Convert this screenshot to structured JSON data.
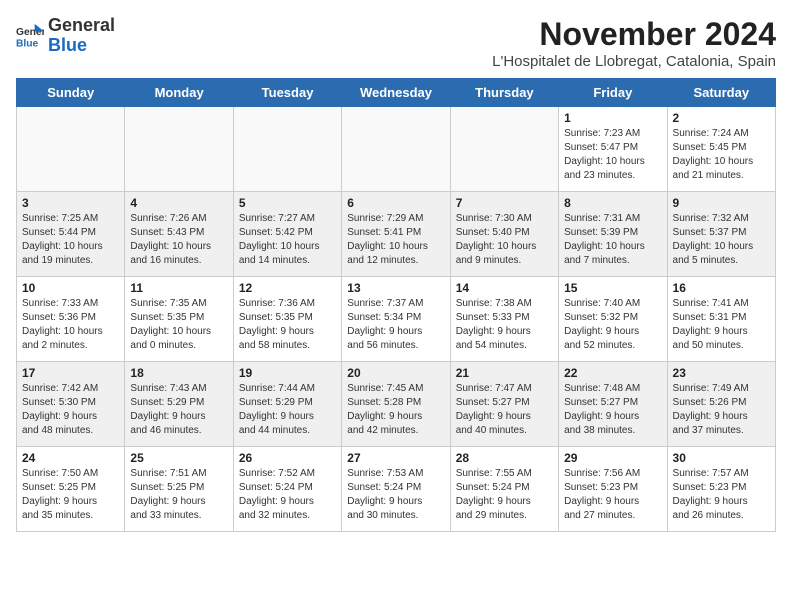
{
  "header": {
    "logo_general": "General",
    "logo_blue": "Blue",
    "month_title": "November 2024",
    "location": "L'Hospitalet de Llobregat, Catalonia, Spain"
  },
  "weekdays": [
    "Sunday",
    "Monday",
    "Tuesday",
    "Wednesday",
    "Thursday",
    "Friday",
    "Saturday"
  ],
  "weeks": [
    [
      {
        "day": "",
        "info": ""
      },
      {
        "day": "",
        "info": ""
      },
      {
        "day": "",
        "info": ""
      },
      {
        "day": "",
        "info": ""
      },
      {
        "day": "",
        "info": ""
      },
      {
        "day": "1",
        "info": "Sunrise: 7:23 AM\nSunset: 5:47 PM\nDaylight: 10 hours\nand 23 minutes."
      },
      {
        "day": "2",
        "info": "Sunrise: 7:24 AM\nSunset: 5:45 PM\nDaylight: 10 hours\nand 21 minutes."
      }
    ],
    [
      {
        "day": "3",
        "info": "Sunrise: 7:25 AM\nSunset: 5:44 PM\nDaylight: 10 hours\nand 19 minutes."
      },
      {
        "day": "4",
        "info": "Sunrise: 7:26 AM\nSunset: 5:43 PM\nDaylight: 10 hours\nand 16 minutes."
      },
      {
        "day": "5",
        "info": "Sunrise: 7:27 AM\nSunset: 5:42 PM\nDaylight: 10 hours\nand 14 minutes."
      },
      {
        "day": "6",
        "info": "Sunrise: 7:29 AM\nSunset: 5:41 PM\nDaylight: 10 hours\nand 12 minutes."
      },
      {
        "day": "7",
        "info": "Sunrise: 7:30 AM\nSunset: 5:40 PM\nDaylight: 10 hours\nand 9 minutes."
      },
      {
        "day": "8",
        "info": "Sunrise: 7:31 AM\nSunset: 5:39 PM\nDaylight: 10 hours\nand 7 minutes."
      },
      {
        "day": "9",
        "info": "Sunrise: 7:32 AM\nSunset: 5:37 PM\nDaylight: 10 hours\nand 5 minutes."
      }
    ],
    [
      {
        "day": "10",
        "info": "Sunrise: 7:33 AM\nSunset: 5:36 PM\nDaylight: 10 hours\nand 2 minutes."
      },
      {
        "day": "11",
        "info": "Sunrise: 7:35 AM\nSunset: 5:35 PM\nDaylight: 10 hours\nand 0 minutes."
      },
      {
        "day": "12",
        "info": "Sunrise: 7:36 AM\nSunset: 5:35 PM\nDaylight: 9 hours\nand 58 minutes."
      },
      {
        "day": "13",
        "info": "Sunrise: 7:37 AM\nSunset: 5:34 PM\nDaylight: 9 hours\nand 56 minutes."
      },
      {
        "day": "14",
        "info": "Sunrise: 7:38 AM\nSunset: 5:33 PM\nDaylight: 9 hours\nand 54 minutes."
      },
      {
        "day": "15",
        "info": "Sunrise: 7:40 AM\nSunset: 5:32 PM\nDaylight: 9 hours\nand 52 minutes."
      },
      {
        "day": "16",
        "info": "Sunrise: 7:41 AM\nSunset: 5:31 PM\nDaylight: 9 hours\nand 50 minutes."
      }
    ],
    [
      {
        "day": "17",
        "info": "Sunrise: 7:42 AM\nSunset: 5:30 PM\nDaylight: 9 hours\nand 48 minutes."
      },
      {
        "day": "18",
        "info": "Sunrise: 7:43 AM\nSunset: 5:29 PM\nDaylight: 9 hours\nand 46 minutes."
      },
      {
        "day": "19",
        "info": "Sunrise: 7:44 AM\nSunset: 5:29 PM\nDaylight: 9 hours\nand 44 minutes."
      },
      {
        "day": "20",
        "info": "Sunrise: 7:45 AM\nSunset: 5:28 PM\nDaylight: 9 hours\nand 42 minutes."
      },
      {
        "day": "21",
        "info": "Sunrise: 7:47 AM\nSunset: 5:27 PM\nDaylight: 9 hours\nand 40 minutes."
      },
      {
        "day": "22",
        "info": "Sunrise: 7:48 AM\nSunset: 5:27 PM\nDaylight: 9 hours\nand 38 minutes."
      },
      {
        "day": "23",
        "info": "Sunrise: 7:49 AM\nSunset: 5:26 PM\nDaylight: 9 hours\nand 37 minutes."
      }
    ],
    [
      {
        "day": "24",
        "info": "Sunrise: 7:50 AM\nSunset: 5:25 PM\nDaylight: 9 hours\nand 35 minutes."
      },
      {
        "day": "25",
        "info": "Sunrise: 7:51 AM\nSunset: 5:25 PM\nDaylight: 9 hours\nand 33 minutes."
      },
      {
        "day": "26",
        "info": "Sunrise: 7:52 AM\nSunset: 5:24 PM\nDaylight: 9 hours\nand 32 minutes."
      },
      {
        "day": "27",
        "info": "Sunrise: 7:53 AM\nSunset: 5:24 PM\nDaylight: 9 hours\nand 30 minutes."
      },
      {
        "day": "28",
        "info": "Sunrise: 7:55 AM\nSunset: 5:24 PM\nDaylight: 9 hours\nand 29 minutes."
      },
      {
        "day": "29",
        "info": "Sunrise: 7:56 AM\nSunset: 5:23 PM\nDaylight: 9 hours\nand 27 minutes."
      },
      {
        "day": "30",
        "info": "Sunrise: 7:57 AM\nSunset: 5:23 PM\nDaylight: 9 hours\nand 26 minutes."
      }
    ]
  ]
}
